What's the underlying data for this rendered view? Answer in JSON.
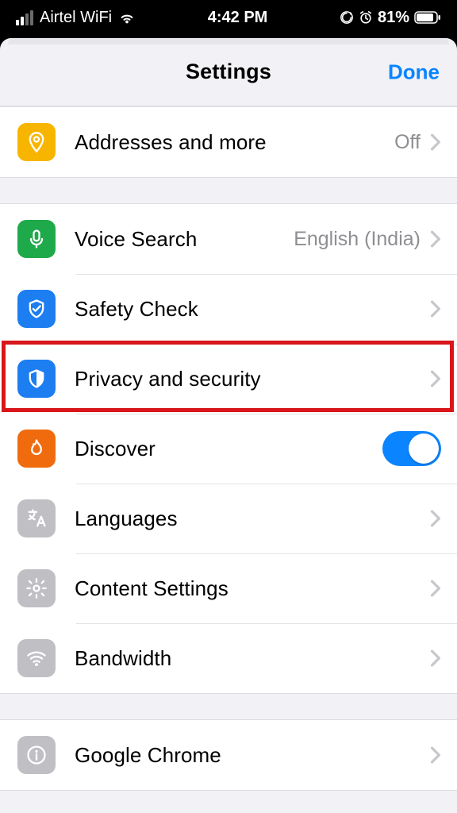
{
  "status": {
    "carrier": "Airtel WiFi",
    "time": "4:42 PM",
    "battery_pct": "81%"
  },
  "nav": {
    "title": "Settings",
    "done": "Done"
  },
  "rows": {
    "addresses": {
      "label": "Addresses and more",
      "detail": "Off"
    },
    "voice": {
      "label": "Voice Search",
      "detail": "English (India)"
    },
    "safety": {
      "label": "Safety Check"
    },
    "privacy": {
      "label": "Privacy and security"
    },
    "discover": {
      "label": "Discover"
    },
    "languages": {
      "label": "Languages"
    },
    "content": {
      "label": "Content Settings"
    },
    "bandwidth": {
      "label": "Bandwidth"
    },
    "chrome": {
      "label": "Google Chrome"
    }
  }
}
